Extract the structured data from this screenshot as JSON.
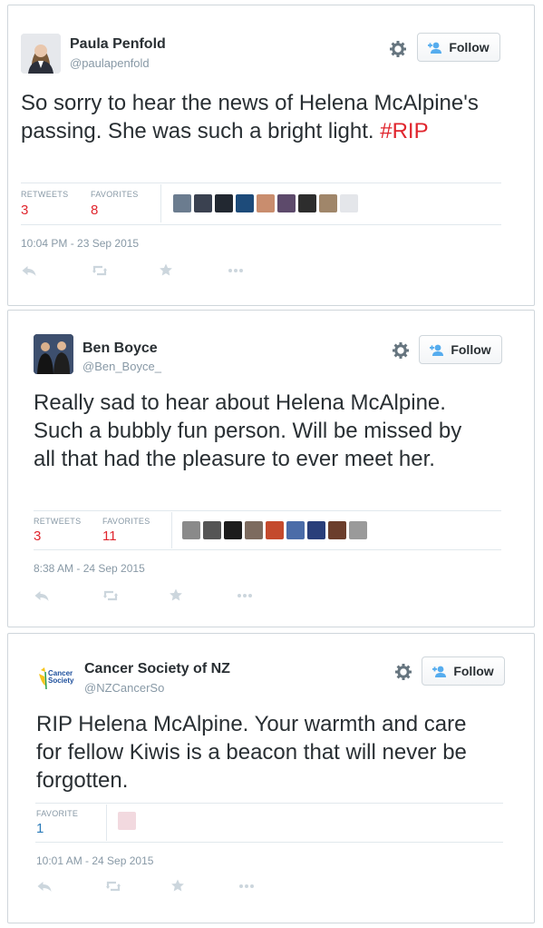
{
  "colors": {
    "retweets": "#e0252d",
    "favorites_red": "#e0252d",
    "favorites_blue": "#2b7bb9",
    "hashtag": "#e0252d",
    "muted": "#8899a6",
    "border": "#cfd6db"
  },
  "tweets": [
    {
      "name": "Paula Penfold",
      "handle": "@paulapenfold",
      "follow_label": "Follow",
      "text_before": "So sorry to hear the news of Helena McAlpine's passing. She was such a bright light. ",
      "hashtag": "#RIP",
      "stats": [
        {
          "label": "RETWEETS",
          "value": "3"
        },
        {
          "label": "FAVORITES",
          "value": "8"
        }
      ],
      "favoriters": [
        "#6b7c8f",
        "#3a4150",
        "#222831",
        "#1d4b7a",
        "#c98d6e",
        "#5d4a6b",
        "#2d2d2d",
        "#a0866a",
        "#e4e6ea"
      ],
      "timestamp": "10:04 PM - 23 Sep 2015"
    },
    {
      "name": "Ben Boyce",
      "handle": "@Ben_Boyce_",
      "follow_label": "Follow",
      "text": "Really sad to hear about Helena McAlpine. Such a bubbly fun person. Will be missed by all that had the pleasure to ever meet her.",
      "stats": [
        {
          "label": "RETWEETS",
          "value": "3"
        },
        {
          "label": "FAVORITES",
          "value": "11"
        }
      ],
      "favoriters": [
        "#8a8a8a",
        "#555555",
        "#1c1c1c",
        "#7d6b5f",
        "#c44a2d",
        "#4b6ca8",
        "#2a3f7a",
        "#6b3e2c",
        "#9a9a9a"
      ],
      "timestamp": "8:38 AM - 24 Sep 2015"
    },
    {
      "name": "Cancer Society of NZ",
      "handle": "@NZCancerSo",
      "follow_label": "Follow",
      "logo_text_1": "Cancer",
      "logo_text_2": "Society",
      "text": "RIP Helena McAlpine. Your warmth and care for fellow Kiwis is a beacon that will never be forgotten.",
      "stats": [
        {
          "label": "FAVORITE",
          "value": "1"
        }
      ],
      "favoriters": [
        "#f2d9df"
      ],
      "timestamp": "10:01 AM - 24 Sep 2015"
    }
  ],
  "actions": {
    "reply": "reply-icon",
    "retweet": "retweet-icon",
    "favorite": "star-icon",
    "more": "more-icon"
  }
}
